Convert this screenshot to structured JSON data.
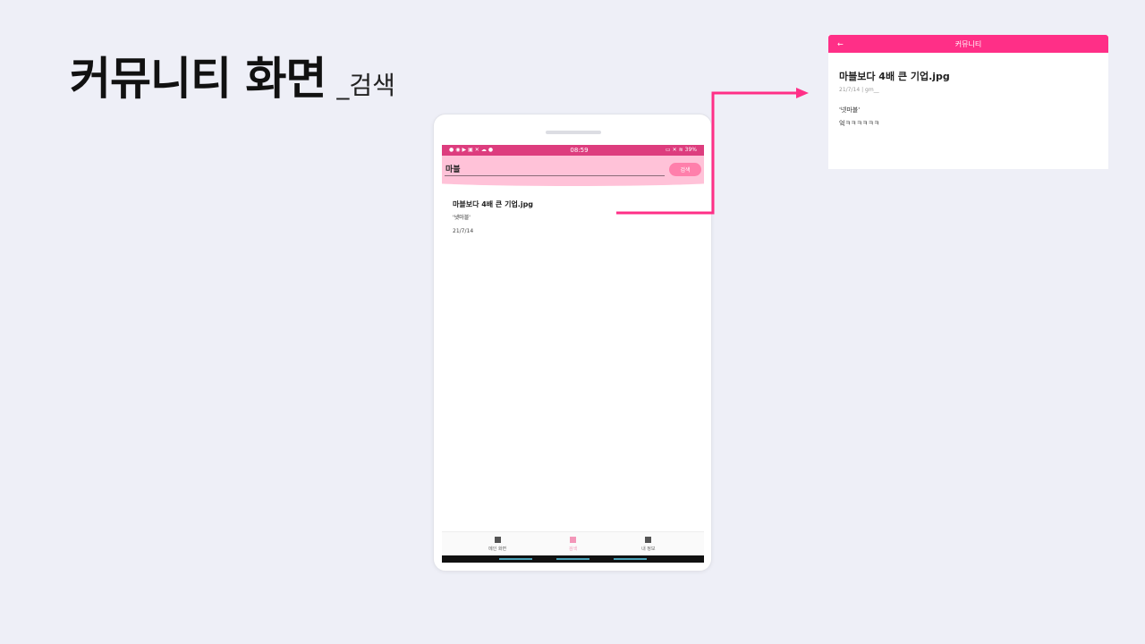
{
  "slide": {
    "title": "커뮤니티 화면",
    "subtitle": "_검색"
  },
  "colors": {
    "accent": "#ff2f87",
    "status_bar": "#dd3d7e",
    "search_bg": "#ffc2d8",
    "search_button": "#ff7fab",
    "background": "#eeeff7"
  },
  "device": {
    "status": {
      "time": "08:59",
      "battery": "39%",
      "left_icons": [
        "record-icon",
        "circle-icon",
        "play-icon",
        "image-icon",
        "close-icon",
        "cloud-icon",
        "circle-icon"
      ],
      "right_icons": [
        "vibrate-icon",
        "mute-icon",
        "wifi-icon"
      ]
    },
    "search": {
      "value": "마블",
      "button_label": "검색"
    },
    "results": [
      {
        "title": "마블보다 4배 큰 기업.jpg",
        "tag": "'넷마블'",
        "date": "21/7/14"
      }
    ],
    "nav": [
      {
        "label": "메인 화면",
        "icon": "home-icon",
        "active": false
      },
      {
        "label": "검색",
        "icon": "search-icon",
        "active": true
      },
      {
        "label": "내 정보",
        "icon": "profile-icon",
        "active": false
      }
    ]
  },
  "detail": {
    "header_title": "커뮤니티",
    "back_icon": "back-arrow-icon",
    "post_title": "마블보다 4배 큰 기업.jpg",
    "meta_date": "21/7/14",
    "meta_separator": "|",
    "meta_author": "gm__",
    "tag": "'넷마블'",
    "content": "엌ㅋㅋㅋㅋㅋㅋ"
  }
}
